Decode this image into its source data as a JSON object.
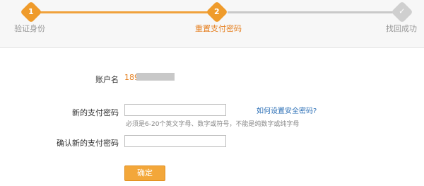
{
  "steps": {
    "items": [
      {
        "number": "1",
        "label": "验证身份"
      },
      {
        "number": "2",
        "label": "重置支付密码"
      },
      {
        "number": "",
        "label": "找回成功"
      }
    ]
  },
  "form": {
    "account_label": "账户名",
    "account_value": "189",
    "new_password_label": "新的支付密码",
    "new_password_value": "",
    "help_link": "如何设置安全密码?",
    "hint": "必须是6-20个英文字母、数字或符号，不能是纯数字或纯字母",
    "confirm_password_label": "确认新的支付密码",
    "confirm_password_value": "",
    "submit_label": "确定"
  },
  "colors": {
    "accent": "#ef9b2b",
    "link": "#2b6fb6",
    "inactive": "#cfcfcf"
  }
}
